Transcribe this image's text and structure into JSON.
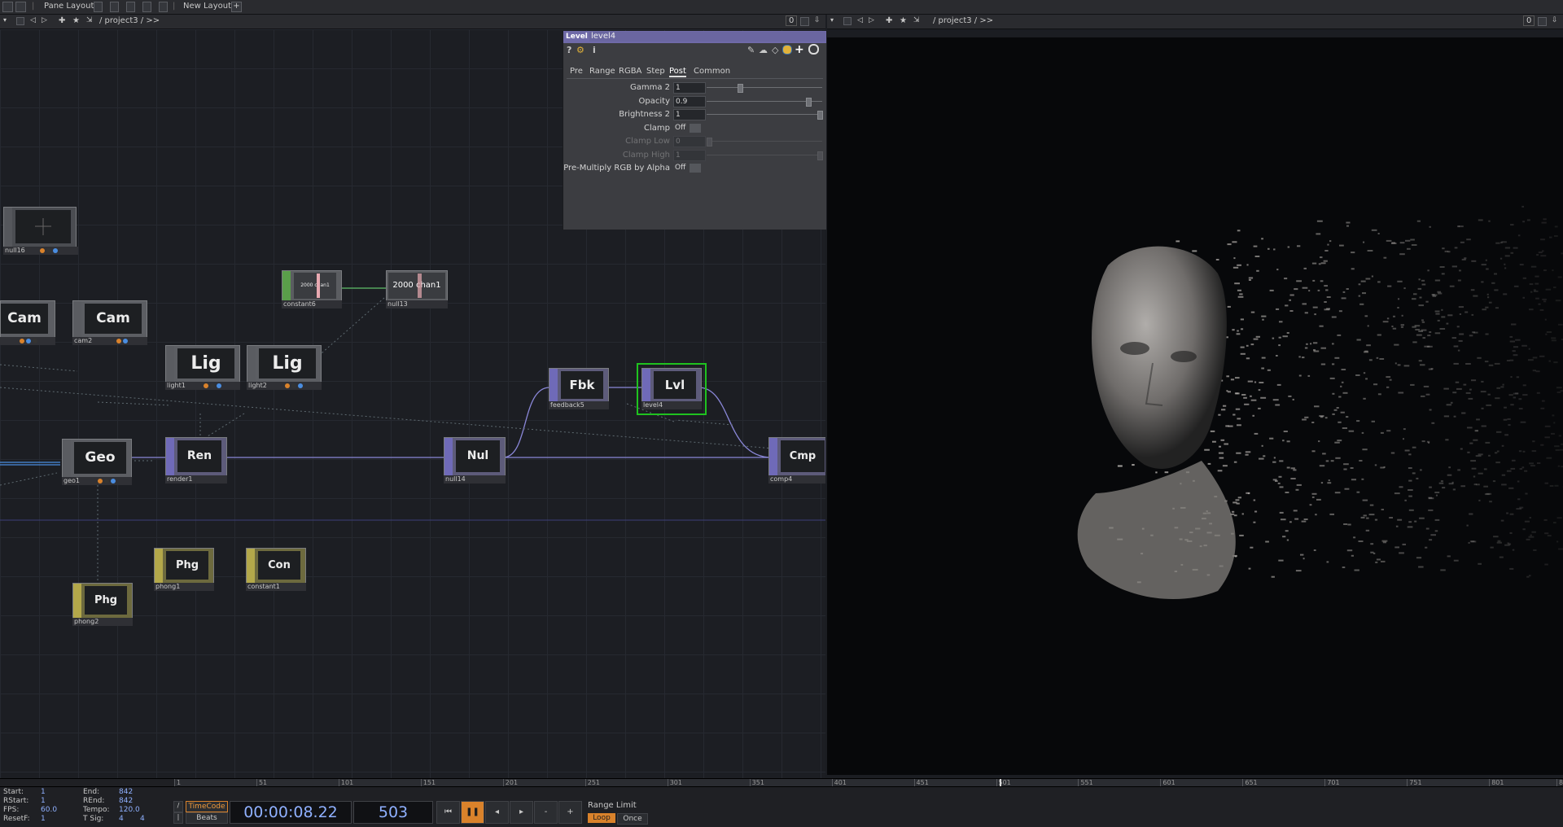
{
  "topbar": {
    "pane_layout": "Pane Layout",
    "new_layout": "New Layout",
    "plus": "+"
  },
  "left_pane": {
    "path": "/ project3 / >>",
    "counter": "0"
  },
  "right_pane": {
    "path": "/ project3 / >>",
    "counter": "0"
  },
  "nodes": {
    "null16": {
      "label": "null16"
    },
    "cam1": {
      "tile": "Cam"
    },
    "cam2": {
      "tile": "Cam",
      "label": "cam2"
    },
    "constant6": {
      "tile": "2000 chan1",
      "label": "constant6"
    },
    "null13": {
      "tile": "2000 chan1",
      "label": "null13"
    },
    "light1": {
      "tile": "Lig",
      "label": "light1"
    },
    "light2": {
      "tile": "Lig",
      "label": "light2"
    },
    "feedback5": {
      "tile": "Fbk",
      "label": "feedback5"
    },
    "level4": {
      "tile": "Lvl",
      "label": "level4"
    },
    "geo1": {
      "tile": "Geo",
      "label": "geo1"
    },
    "render1": {
      "tile": "Ren",
      "label": "render1"
    },
    "null14": {
      "tile": "Nul",
      "label": "null14"
    },
    "comp4": {
      "tile": "Cmp",
      "label": "comp4"
    },
    "phong1": {
      "tile": "Phg",
      "label": "phong1"
    },
    "constant1": {
      "tile": "Con",
      "label": "constant1"
    },
    "phong2": {
      "tile": "Phg",
      "label": "phong2"
    }
  },
  "params": {
    "op_type": "Level",
    "op_name": "level4",
    "tabs": [
      "Pre",
      "Range",
      "RGBA",
      "Step",
      "Post",
      "Common"
    ],
    "active_tab": "Post",
    "rows": [
      {
        "label": "Gamma 2",
        "value": "1",
        "slider": 0.28
      },
      {
        "label": "Opacity",
        "value": "0.9",
        "slider": 0.9
      },
      {
        "label": "Brightness 2",
        "value": "1",
        "slider": 1.0
      },
      {
        "label": "Clamp",
        "value": "Off",
        "toggle": true
      },
      {
        "label": "Clamp Low",
        "value": "0",
        "slider": 0.0,
        "disabled": true
      },
      {
        "label": "Clamp High",
        "value": "1",
        "slider": 1.0,
        "disabled": true
      },
      {
        "label": "Pre-Multiply RGB by Alpha",
        "value": "Off",
        "toggle": true
      }
    ]
  },
  "timeline": {
    "ticks": [
      "1",
      "51",
      "101",
      "151",
      "201",
      "251",
      "301",
      "351",
      "401",
      "451",
      "501",
      "551",
      "601",
      "651",
      "701",
      "751",
      "801",
      "842"
    ],
    "playhead_frame": 503,
    "range_start": 1,
    "range_end": 842
  },
  "stats": {
    "start_label": "Start:",
    "start": "1",
    "rstart_label": "RStart:",
    "rstart": "1",
    "fps_label": "FPS:",
    "fps": "60.0",
    "resetf_label": "ResetF:",
    "resetf": "1",
    "end_label": "End:",
    "end": "842",
    "rend_label": "REnd:",
    "rend": "842",
    "tempo_label": "Tempo:",
    "tempo": "120.0",
    "tsig_label": "T Sig:",
    "tsig1": "4",
    "tsig2": "4"
  },
  "transport": {
    "timecode_btn": "TimeCode",
    "beats_btn": "Beats",
    "timecode": "00:00:08.22",
    "frame": "503",
    "range_limit": "Range Limit",
    "loop": "Loop",
    "once": "Once",
    "minus": "-",
    "plus": "+"
  },
  "colors": {
    "top_accent": "#6f6aa8",
    "selected": "#1fc21f",
    "wire": "#8a87d8",
    "orange": "#d9822b"
  }
}
